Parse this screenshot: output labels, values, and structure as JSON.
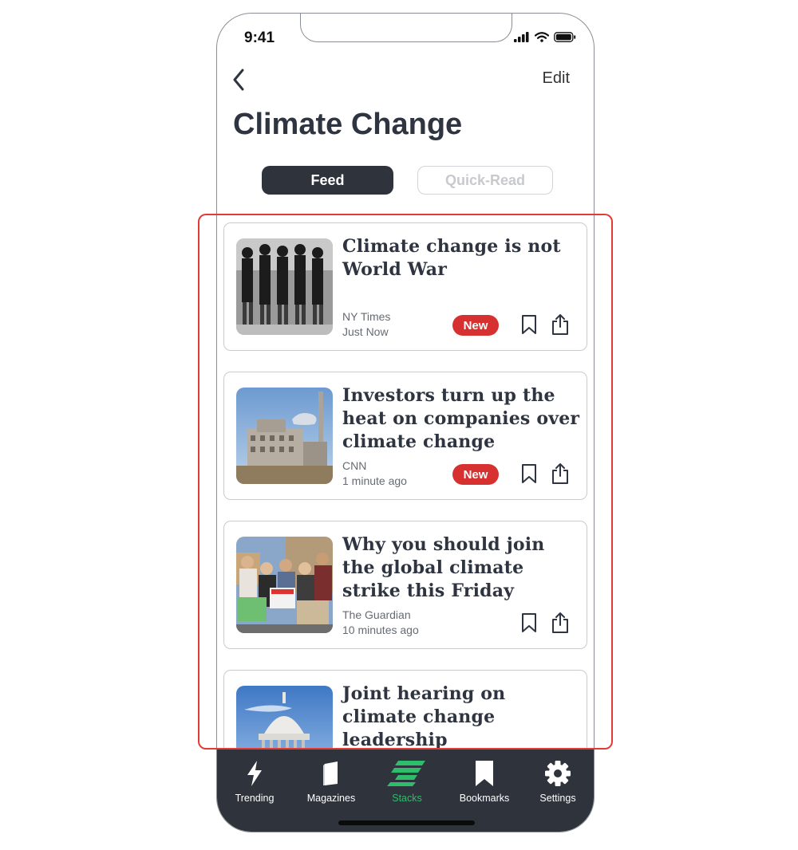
{
  "status_bar": {
    "time": "9:41"
  },
  "header": {
    "back_icon": "chevron-left-icon",
    "edit_label": "Edit",
    "title": "Climate Change"
  },
  "segments": {
    "feed": "Feed",
    "quick_read": "Quick-Read",
    "active": "feed"
  },
  "articles": [
    {
      "headline": "Climate change is not World War",
      "source": "NY Times",
      "time": "Just Now",
      "badge": "New",
      "image": "soldiers-marching-bw-photo"
    },
    {
      "headline": "Investors turn up the heat on companies over climate change",
      "source": "CNN",
      "time": "1 minute ago",
      "badge": "New",
      "image": "power-plant-photo"
    },
    {
      "headline": "Why you should join the global climate strike this Friday",
      "source": "The Guardian",
      "time": "10 minutes ago",
      "badge": "",
      "image": "climate-protesters-photo"
    },
    {
      "headline": "Joint hearing on climate change leadership",
      "source": "",
      "time": "",
      "badge": "",
      "image": "capitol-dome-photo"
    }
  ],
  "tabbar": [
    {
      "label": "Trending",
      "icon": "lightning-icon"
    },
    {
      "label": "Magazines",
      "icon": "magazine-icon"
    },
    {
      "label": "Stacks",
      "icon": "stacks-icon",
      "active": true
    },
    {
      "label": "Bookmarks",
      "icon": "bookmark-icon"
    },
    {
      "label": "Settings",
      "icon": "gear-icon"
    }
  ],
  "colors": {
    "accent": "#2ebd6b",
    "badge": "#d63031",
    "dark": "#2e333c",
    "highlight_box": "#e33b34"
  }
}
